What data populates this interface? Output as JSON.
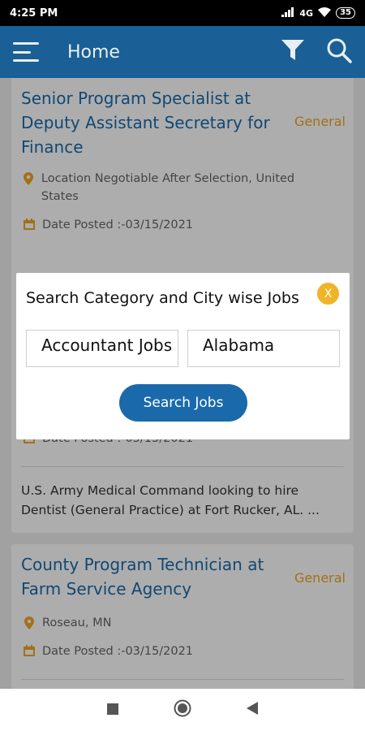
{
  "status_bar": {
    "time": "4:25 PM",
    "network": "4G",
    "battery": "35"
  },
  "app_bar": {
    "title": "Home"
  },
  "jobs": [
    {
      "title": "Senior Program Specialist at Deputy Assistant Secretary for Finance",
      "category": "General",
      "location": "Location Negotiable After Selection, United States",
      "date_posted": "Date Posted :-03/15/2021"
    },
    {
      "date_posted": "Date Posted :-03/15/2021",
      "description": "U.S. Army Medical Command looking to hire Dentist (General Practice) at Fort Rucker, AL. ..."
    },
    {
      "title": "County Program Technician at Farm Service Agency",
      "category": "General",
      "location": "Roseau, MN",
      "date_posted": "Date Posted :-03/15/2021"
    }
  ],
  "dialog": {
    "title": "Search Category and City wise Jobs",
    "close_label": "X",
    "category_value": "Accountant Jobs",
    "city_value": "Alabama",
    "search_button": "Search Jobs"
  },
  "colors": {
    "primary": "#1a5f96",
    "accent": "#f0a626",
    "link": "#1a6aab"
  }
}
